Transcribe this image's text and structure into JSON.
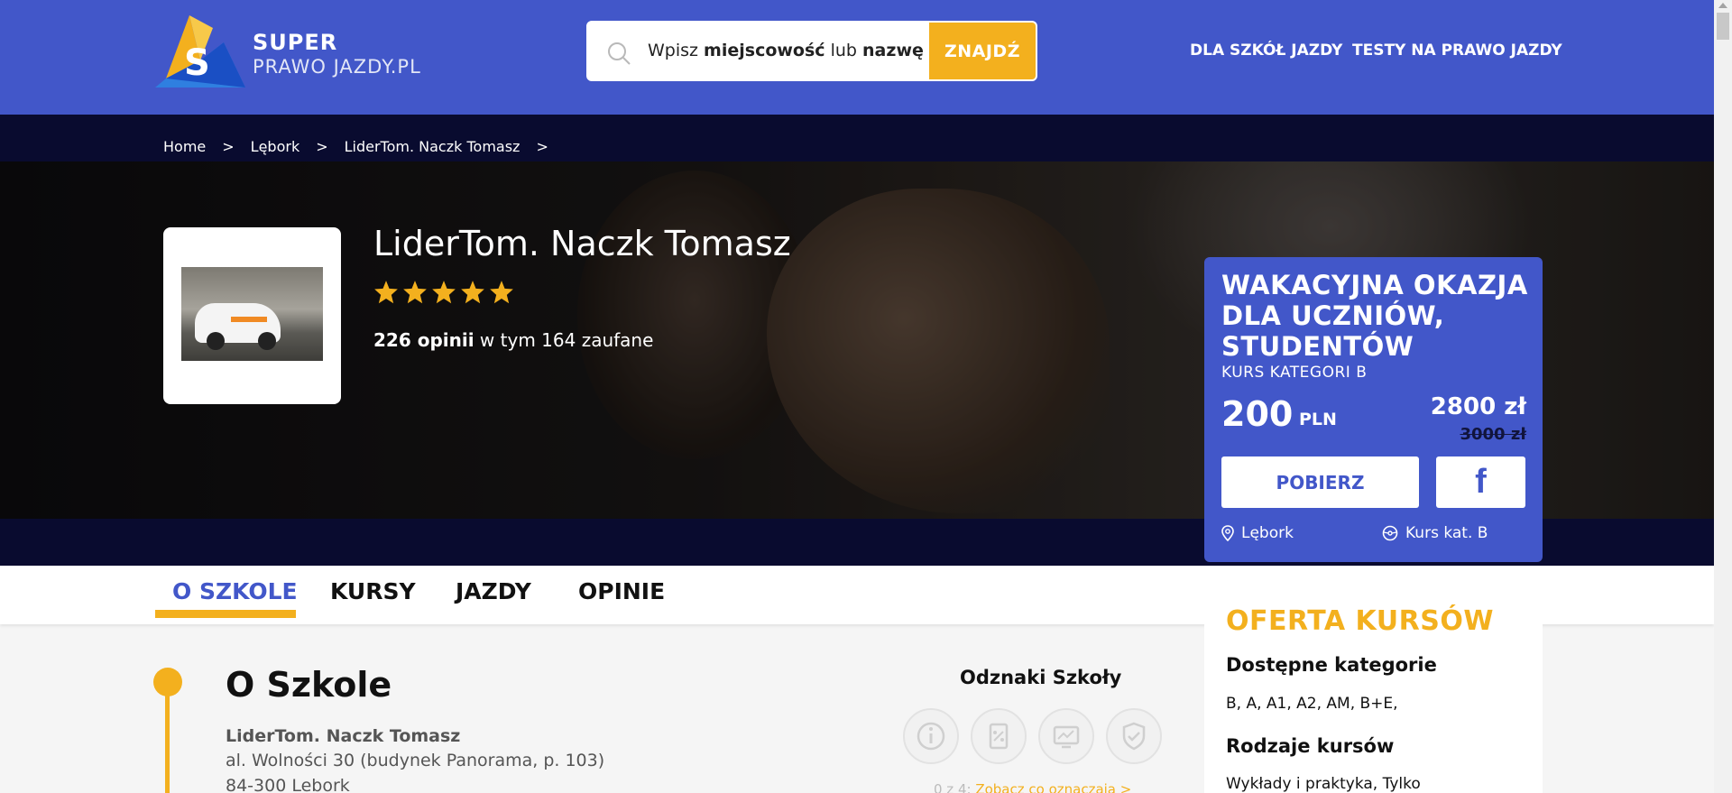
{
  "header": {
    "logo_line1": "SUPER",
    "logo_line2": "PRAWO JAZDY.PL",
    "logo_letter": "S",
    "search": {
      "placeholder_pre": "Wpisz ",
      "placeholder_bold1": "miejscowość",
      "placeholder_mid": " lub ",
      "placeholder_bold2": "nazwę",
      "button": "ZNAJDŹ"
    },
    "nav": [
      "DLA SZKÓŁ JAZDY",
      "TESTY NA PRAWO JAZDY"
    ]
  },
  "breadcrumb": {
    "items": [
      "Home",
      "Lębork",
      "LiderTom. Naczk Tomasz"
    ],
    "separator": ">"
  },
  "school": {
    "name": "LiderTom. Naczk Tomasz",
    "rating": 5,
    "reviews_count": "226 opinii",
    "reviews_rest": " w tym 164 zaufane"
  },
  "promo": {
    "title": "WAKACYJNA OKAZJA DLA UCZNIÓW, STUDENTÓW",
    "subtitle": "KURS KATEGORI B",
    "discount": "200",
    "discount_currency": "PLN",
    "new_price": "2800 zł",
    "old_price": "3000 zł",
    "button": "POBIERZ",
    "share_icon": "f",
    "location": "Lębork",
    "course": "Kurs kat. B"
  },
  "tabs": [
    "O SZKOLE",
    "KURSY",
    "JAZDY",
    "OPINIE"
  ],
  "offer": {
    "title": "OFERTA KURSÓW",
    "categories_heading": "Dostępne kategorie",
    "categories": "B, A, A1, A2, AM, B+E,",
    "kinds_heading": "Rodzaje kursów",
    "kinds": "Wykłady i praktyka, Tylko"
  },
  "about": {
    "title": "O Szkole",
    "name": "LiderTom. Naczk Tomasz",
    "address": "al. Wolności 30 (budynek Panorama, p. 103)",
    "city": "84-300 Lebork"
  },
  "badges": {
    "title": "Odznaki Szkoły",
    "icons": [
      "info-badge-icon",
      "percent-badge-icon",
      "chart-badge-icon",
      "shield-badge-icon"
    ],
    "count": "0 z 4:",
    "link": " Zobacz co oznaczają >"
  },
  "colors": {
    "brand_blue": "#4257c9",
    "accent_yellow": "#f3b01e",
    "dark_navy": "#090b2f"
  }
}
